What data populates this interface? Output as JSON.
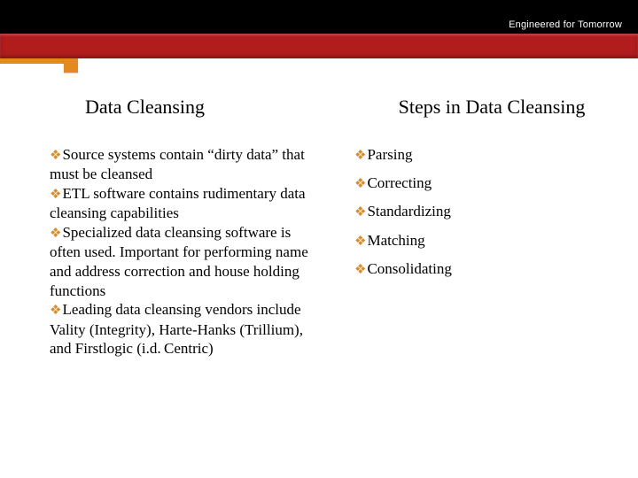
{
  "header": {
    "tagline": "Engineered for Tomorrow"
  },
  "left": {
    "heading": "Data Cleansing",
    "bullets": [
      "Source systems contain “dirty data” that must be cleansed",
      "ETL software contains rudimentary data cleansing capabilities",
      "Specialized data cleansing software is often used.  Important for performing name and address correction and house holding functions",
      "Leading data cleansing vendors include Vality (Integrity), Harte-Hanks (Trillium), and Firstlogic (i.d. Centric)"
    ]
  },
  "right": {
    "heading": "Steps in Data Cleansing",
    "bullets": [
      "Parsing",
      "Correcting",
      "Standardizing",
      "Matching",
      "Consolidating"
    ]
  },
  "icons": {
    "bullet_glyph": "❖"
  }
}
